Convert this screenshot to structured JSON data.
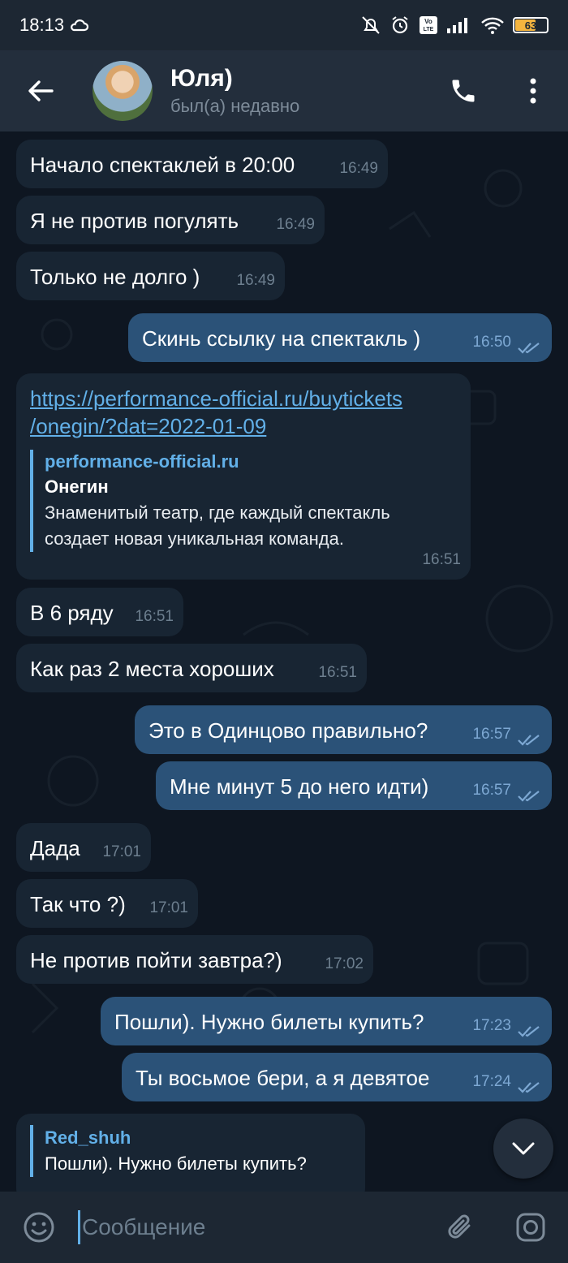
{
  "status_bar": {
    "time": "18:13",
    "battery": "63"
  },
  "header": {
    "title": "Юля)",
    "subtitle": "был(а) недавно"
  },
  "messages": [
    {
      "dir": "in",
      "text": "Начало спектаклей в 20:00",
      "time": "16:49"
    },
    {
      "dir": "in",
      "text": "Я не против погулять",
      "time": "16:49"
    },
    {
      "dir": "in",
      "text": "Только не долго )",
      "time": "16:49"
    },
    {
      "dir": "out",
      "text": "Скинь ссылку на спектакль )",
      "time": "16:50"
    },
    {
      "dir": "in",
      "link_line1": "https://performance-official.ru/buytickets",
      "link_line2": "/onegin/?dat=2022-01-09",
      "preview_site": "performance-official.ru",
      "preview_title": "Онегин",
      "preview_desc1": "Знаменитый театр, где каждый спектакль",
      "preview_desc2": "создает новая уникальная команда.",
      "time": "16:51"
    },
    {
      "dir": "in",
      "text": "В 6 ряду",
      "time": "16:51"
    },
    {
      "dir": "in",
      "text": "Как раз 2 места хороших",
      "time": "16:51"
    },
    {
      "dir": "out",
      "text": "Это в Одинцово правильно?",
      "time": "16:57"
    },
    {
      "dir": "out",
      "text": "Мне минут 5 до него идти)",
      "time": "16:57"
    },
    {
      "dir": "in",
      "text": "Дада",
      "time": "17:01"
    },
    {
      "dir": "in",
      "text": "Так что ?)",
      "time": "17:01"
    },
    {
      "dir": "in",
      "text": "Не против пойти завтра?)",
      "time": "17:02"
    },
    {
      "dir": "out",
      "text": "Пошли). Нужно билеты купить?",
      "time": "17:23"
    },
    {
      "dir": "out",
      "text": "Ты восьмое бери, а я девятое",
      "time": "17:24"
    },
    {
      "dir": "in",
      "reply_name": "Red_shuh",
      "reply_text": "Пошли). Нужно билеты купить?"
    }
  ],
  "input": {
    "placeholder": "Сообщение"
  }
}
